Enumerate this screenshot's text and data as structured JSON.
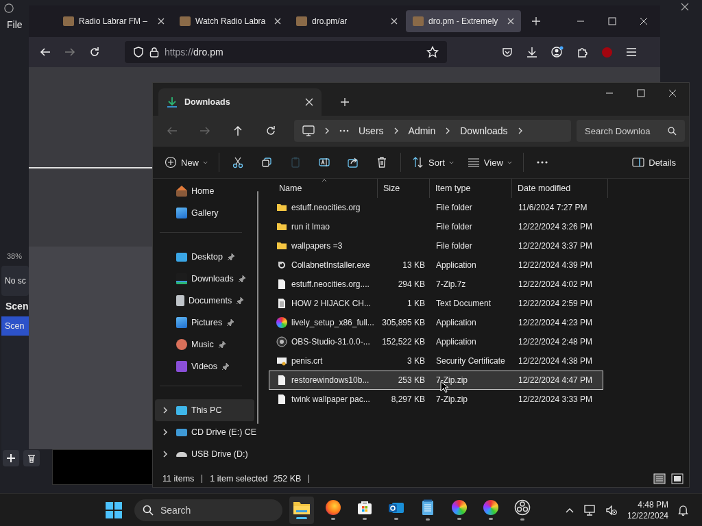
{
  "obs": {
    "menu": [
      "File"
    ],
    "zoom": "38%",
    "sources_text": "No sc",
    "scenes_header": "Scen",
    "scenes": [
      {
        "label": "Scen",
        "selected": true
      }
    ]
  },
  "browser": {
    "tabs": [
      {
        "title": "Radio Labrar FM –",
        "selected": false
      },
      {
        "title": "Watch Radio Labra",
        "selected": false
      },
      {
        "title": "dro.pm/ar",
        "selected": false
      },
      {
        "title": "dro.pm - Extremely",
        "selected": true
      }
    ],
    "url_scheme": "https://",
    "url_host": "dro.pm"
  },
  "explorer": {
    "tab": "Downloads",
    "breadcrumb": [
      "Users",
      "Admin",
      "Downloads"
    ],
    "search": {
      "placeholder": "Search Downloa"
    },
    "toolbar": [
      {
        "kind": "new",
        "label": "New",
        "disabled": false
      },
      {
        "kind": "cut",
        "disabled": false
      },
      {
        "kind": "copy",
        "disabled": false
      },
      {
        "kind": "paste",
        "disabled": true
      },
      {
        "kind": "rename",
        "disabled": false
      },
      {
        "kind": "share",
        "disabled": false
      },
      {
        "kind": "delete",
        "disabled": false
      },
      {
        "kind": "sort",
        "label": "Sort",
        "disabled": false
      },
      {
        "kind": "view",
        "label": "View",
        "disabled": false
      },
      {
        "kind": "more",
        "disabled": false
      },
      {
        "kind": "details",
        "label": "Details",
        "disabled": false
      }
    ],
    "sidebar": {
      "top": [
        {
          "kind": "home",
          "label": "Home"
        },
        {
          "kind": "gallery",
          "label": "Gallery"
        }
      ],
      "pinned": [
        {
          "kind": "desktop",
          "label": "Desktop",
          "pinned": true
        },
        {
          "kind": "downloads",
          "label": "Downloads",
          "pinned": true
        },
        {
          "kind": "documents",
          "label": "Documents",
          "pinned": true
        },
        {
          "kind": "pictures",
          "label": "Pictures",
          "pinned": true
        },
        {
          "kind": "music",
          "label": "Music",
          "pinned": true
        },
        {
          "kind": "videos",
          "label": "Videos",
          "pinned": true
        }
      ],
      "drives": [
        {
          "kind": "pc",
          "label": "This PC",
          "selected": true
        },
        {
          "kind": "cd",
          "label": "CD Drive (E:) CE",
          "selected": false
        },
        {
          "kind": "usb",
          "label": "USB Drive (D:)",
          "selected": false
        }
      ]
    },
    "columns": [
      "Name",
      "Size",
      "Item type",
      "Date modified"
    ],
    "rows": [
      {
        "kind": "folder",
        "name": "estuff.neocities.org",
        "size": "",
        "type": "File folder",
        "date": "11/6/2024 7:27 PM",
        "selected": false
      },
      {
        "kind": "folder",
        "name": "run it lmao",
        "size": "",
        "type": "File folder",
        "date": "12/22/2024 3:26 PM",
        "selected": false
      },
      {
        "kind": "folder",
        "name": "wallpapers =3",
        "size": "",
        "type": "File folder",
        "date": "12/22/2024 3:37 PM",
        "selected": false
      },
      {
        "kind": "installer",
        "name": "CollabnetInstaller.exe",
        "size": "13 KB",
        "type": "Application",
        "date": "12/22/2024 4:39 PM",
        "selected": false
      },
      {
        "kind": "file",
        "name": "estuff.neocities.org....",
        "size": "294 KB",
        "type": "7-Zip.7z",
        "date": "12/22/2024 4:02 PM",
        "selected": false
      },
      {
        "kind": "text",
        "name": "HOW 2 HIJACK CH...",
        "size": "1 KB",
        "type": "Text Document",
        "date": "12/22/2024 2:59 PM",
        "selected": false
      },
      {
        "kind": "wheel",
        "name": "lively_setup_x86_full...",
        "size": "305,895 KB",
        "type": "Application",
        "date": "12/22/2024 4:23 PM",
        "selected": false
      },
      {
        "kind": "disc",
        "name": "OBS-Studio-31.0.0-...",
        "size": "152,522 KB",
        "type": "Application",
        "date": "12/22/2024 2:48 PM",
        "selected": false
      },
      {
        "kind": "cert",
        "name": "penis.crt",
        "size": "3 KB",
        "type": "Security Certificate",
        "date": "12/22/2024 4:38 PM",
        "selected": false
      },
      {
        "kind": "file",
        "name": "restorewindows10b...",
        "size": "253 KB",
        "type": "7-Zip.zip",
        "date": "12/22/2024 4:47 PM",
        "selected": true
      },
      {
        "kind": "file",
        "name": "twink wallpaper pac...",
        "size": "8,297 KB",
        "type": "7-Zip.zip",
        "date": "12/22/2024 3:33 PM",
        "selected": false
      }
    ],
    "status": {
      "count": "11 items",
      "selection": "1 item selected",
      "size": "252 KB"
    }
  },
  "taskbar": {
    "search": {
      "placeholder": "Search"
    },
    "apps": [
      {
        "kind": "folder",
        "selected": true
      },
      {
        "kind": "browser",
        "selected": false
      },
      {
        "kind": "store",
        "selected": false
      },
      {
        "kind": "mail",
        "selected": false
      },
      {
        "kind": "notepad",
        "selected": false
      },
      {
        "kind": "wheel",
        "selected": false
      },
      {
        "kind": "wheel",
        "selected": false
      },
      {
        "kind": "disc",
        "selected": false
      }
    ],
    "time": "4:48 PM",
    "date": "12/22/2024"
  }
}
